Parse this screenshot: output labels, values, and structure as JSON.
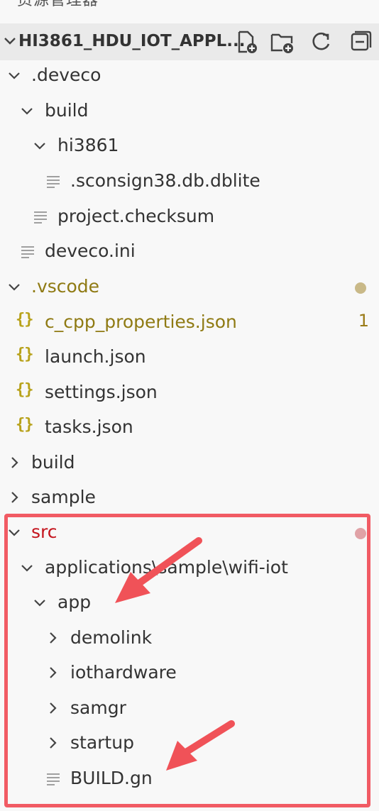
{
  "explorer": {
    "title": "资源管理器"
  },
  "project": {
    "name": "HI3861_HDU_IOT_APPL..."
  },
  "header_actions": [
    "new-file-icon",
    "new-folder-icon",
    "refresh-icon",
    "collapse-all-icon"
  ],
  "tree": {
    "deveco": ".deveco",
    "deveco_build": "build",
    "hi3861": "hi3861",
    "sconsign": ".sconsign38.db.dblite",
    "checksum": "project.checksum",
    "deveco_ini": "deveco.ini",
    "vscode": ".vscode",
    "c_cpp": "c_cpp_properties.json",
    "c_cpp_problems": "1",
    "launch": "launch.json",
    "settings": "settings.json",
    "tasks": "tasks.json",
    "build": "build",
    "sample": "sample",
    "src": "src",
    "applications_path": "applications\\sample\\wifi-iot",
    "app": "app",
    "demolink": "demolink",
    "iothardware": "iothardware",
    "samgr": "samgr",
    "startup": "startup",
    "build_gn": "BUILD.gn"
  },
  "json_icon_glyph": "{}",
  "colors": {
    "modified": "#8f7a13",
    "modified_dot": "#c9b988",
    "error": "#c4141d",
    "error_dot": "#e0a2a6",
    "highlight": "#f15b64"
  }
}
